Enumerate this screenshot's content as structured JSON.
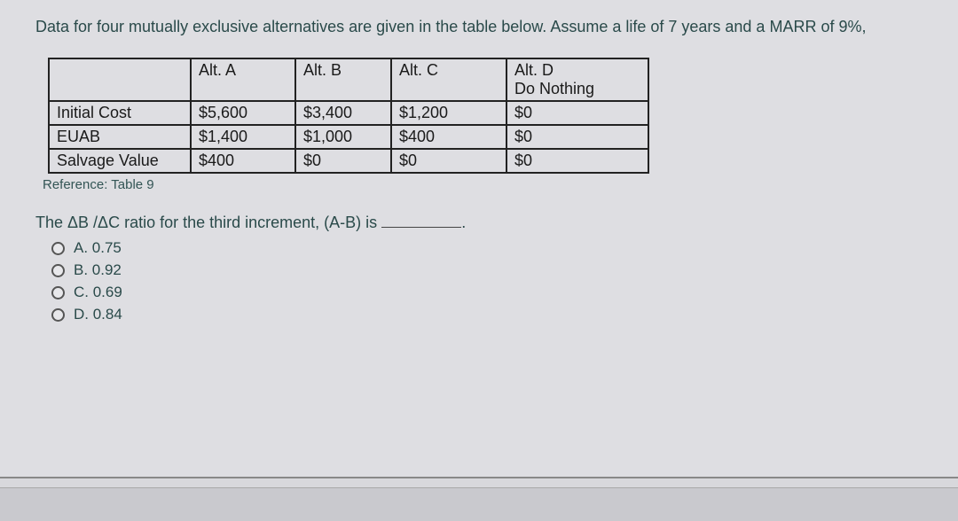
{
  "intro": "Data for four mutually exclusive alternatives are given in the table below. Assume a life of 7 years and a MARR of 9%,",
  "table": {
    "headers": {
      "blank": "",
      "a": "Alt. A",
      "b": "Alt. B",
      "c": "Alt. C",
      "d_line1": "Alt. D",
      "d_line2": "Do Nothing"
    },
    "rows": {
      "initial_cost": {
        "label": "Initial Cost",
        "a": "$5,600",
        "b": "$3,400",
        "c": "$1,200",
        "d": "$0"
      },
      "euab": {
        "label": "EUAB",
        "a": "$1,400",
        "b": "$1,000",
        "c": "$400",
        "d": "$0"
      },
      "salvage": {
        "label": "Salvage Value",
        "a": "$400",
        "b": "$0",
        "c": "$0",
        "d": "$0"
      }
    }
  },
  "reference": "Reference: Table 9",
  "question": "The ΔB /ΔC ratio for the third increment, (A-B) is",
  "options": {
    "a": "A. 0.75",
    "b": "B. 0.92",
    "c": "C. 0.69",
    "d": "D. 0.84"
  }
}
